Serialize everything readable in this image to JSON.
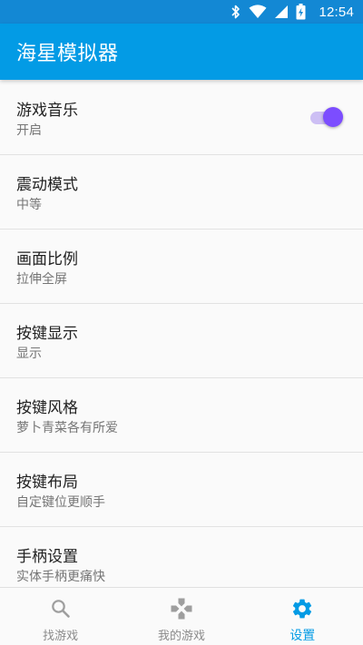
{
  "status_bar": {
    "time": "12:54",
    "icons": [
      "bluetooth-icon",
      "wifi-icon",
      "cell-signal-icon",
      "battery-charging-icon"
    ]
  },
  "app_bar": {
    "title": "海星模拟器"
  },
  "colors": {
    "status_bar": "#1388d4",
    "app_bar": "#039be5",
    "accent": "#7c4dff",
    "switch_track": "#cdbff4",
    "nav_active": "#039be5",
    "nav_inactive": "#9e9e9e"
  },
  "settings": [
    {
      "title": "游戏音乐",
      "value": "开启",
      "toggle_on": true
    },
    {
      "title": "震动模式",
      "value": "中等"
    },
    {
      "title": "画面比例",
      "value": "拉伸全屏"
    },
    {
      "title": "按键显示",
      "value": "显示"
    },
    {
      "title": "按键风格",
      "value": "萝卜青菜各有所爱"
    },
    {
      "title": "按键布局",
      "value": "自定键位更顺手"
    },
    {
      "title": "手柄设置",
      "value": "实体手柄更痛快"
    }
  ],
  "bottom_nav": [
    {
      "label": "找游戏",
      "icon": "search-icon",
      "active": false
    },
    {
      "label": "我的游戏",
      "icon": "gamepad-icon",
      "active": false
    },
    {
      "label": "设置",
      "icon": "gear-icon",
      "active": true
    }
  ]
}
